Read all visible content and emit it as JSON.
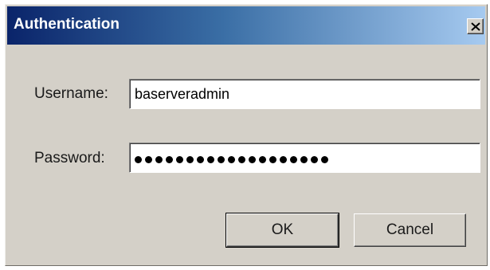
{
  "window": {
    "title": "Authentication",
    "close_glyph": "close-icon"
  },
  "form": {
    "username_label": "Username:",
    "username_value": "baserveradmin",
    "password_label": "Password:",
    "password_mask_count": 19
  },
  "buttons": {
    "ok_label": "OK",
    "cancel_label": "Cancel"
  },
  "colors": {
    "titlebar_start": "#0a246a",
    "titlebar_end": "#a6caf0",
    "dialog_background": "#d4d0c8"
  }
}
